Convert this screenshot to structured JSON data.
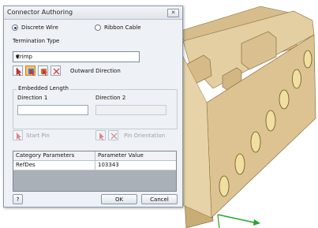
{
  "dialog": {
    "title": "Connector Authoring",
    "close_glyph": "✕",
    "wire_type": {
      "discrete_label": "Discrete Wire",
      "ribbon_label": "Ribbon Cable",
      "selected": "Discrete Wire"
    },
    "termination_type": {
      "label": "Termination Type",
      "value": "Crimp"
    },
    "direction_tools": {
      "outward_direction_label": "Outward Direction"
    },
    "embedded_length": {
      "group_label": "Embedded Length",
      "direction1_label": "Direction 1",
      "direction1_value": "",
      "direction2_label": "Direction 2",
      "direction2_value": ""
    },
    "start_pin_label": "Start Pin",
    "pin_orientation_label": "Pin Orientation",
    "parameters_table": {
      "columns": [
        "Category Parameters",
        "Parameter Value"
      ],
      "rows": [
        [
          "RefDes",
          "103343"
        ]
      ]
    },
    "buttons": {
      "help_glyph": "?",
      "ok": "OK",
      "cancel": "Cancel"
    }
  },
  "colors": {
    "part_body": "#e0c99a",
    "part_shadow": "#b99a63",
    "hole_glow": "#f2e2a0",
    "axis_arrow": "#2aa52a",
    "pressed_tool": "#f3c16a"
  }
}
